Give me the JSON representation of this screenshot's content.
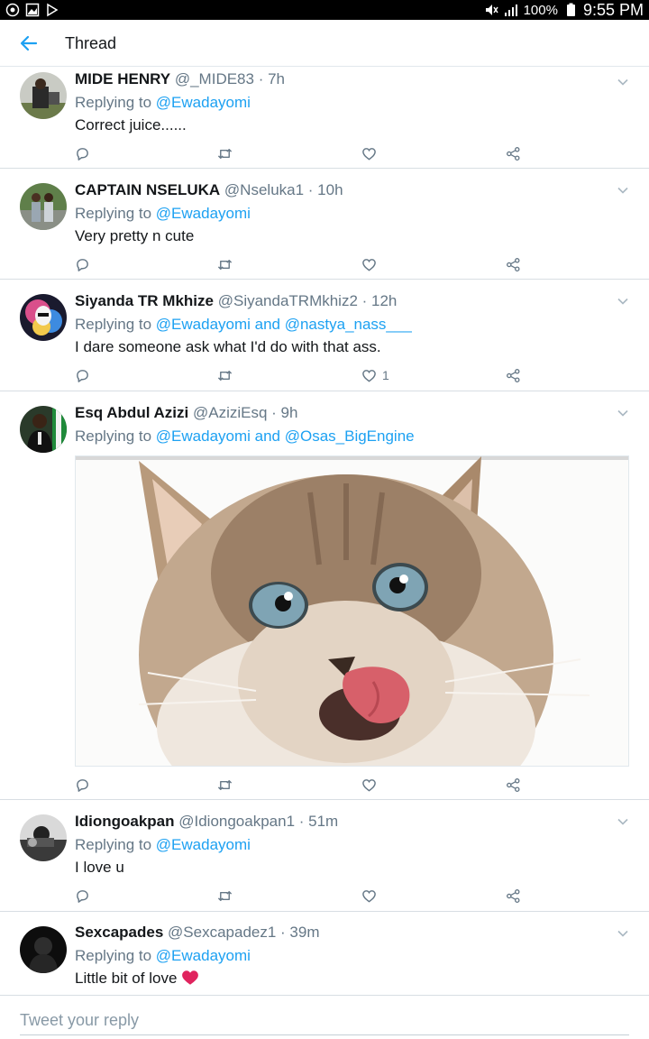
{
  "status": {
    "battery": "100%",
    "time": "9:55 PM"
  },
  "appbar": {
    "title": "Thread"
  },
  "colors": {
    "accent": "#1da1f2",
    "secondary": "#657786",
    "heart": "#e0245e"
  },
  "tweets": [
    {
      "name": "MIDE HENRY",
      "handle": "@_MIDE83 · 7h",
      "reply_prefix": "Replying to ",
      "reply_to": "@Ewadayomi",
      "text": "Correct juice......",
      "like_count": ""
    },
    {
      "name": "CAPTAIN NSELUKA",
      "handle": "@Nseluka1 · 10h",
      "reply_prefix": "Replying to ",
      "reply_to": "@Ewadayomi",
      "text": "Very pretty n cute",
      "like_count": ""
    },
    {
      "name": "Siyanda TR Mkhize",
      "handle": "@SiyandaTRMkhiz2 · 12h",
      "reply_prefix": "Replying to ",
      "reply_to": "@Ewadayomi and @nastya_nass___",
      "text": "I dare someone ask what I'd do with that ass.",
      "like_count": "1"
    },
    {
      "name": "Esq Abdul Azizi",
      "handle": "@AziziEsq · 9h",
      "reply_prefix": "Replying to ",
      "reply_to": "@Ewadayomi and @Osas_BigEngine",
      "text": "",
      "like_count": ""
    },
    {
      "name": "Idiongoakpan",
      "handle": "@Idiongoakpan1 · 51m",
      "reply_prefix": "Replying to ",
      "reply_to": "@Ewadayomi",
      "text": "I love u",
      "like_count": ""
    },
    {
      "name": "Sexcapades",
      "handle": "@Sexcapadez1 · 39m",
      "reply_prefix": "Replying to ",
      "reply_to": "@Ewadayomi",
      "text": "Little bit of love",
      "like_count": ""
    }
  ],
  "compose": {
    "placeholder": "Tweet your reply"
  }
}
